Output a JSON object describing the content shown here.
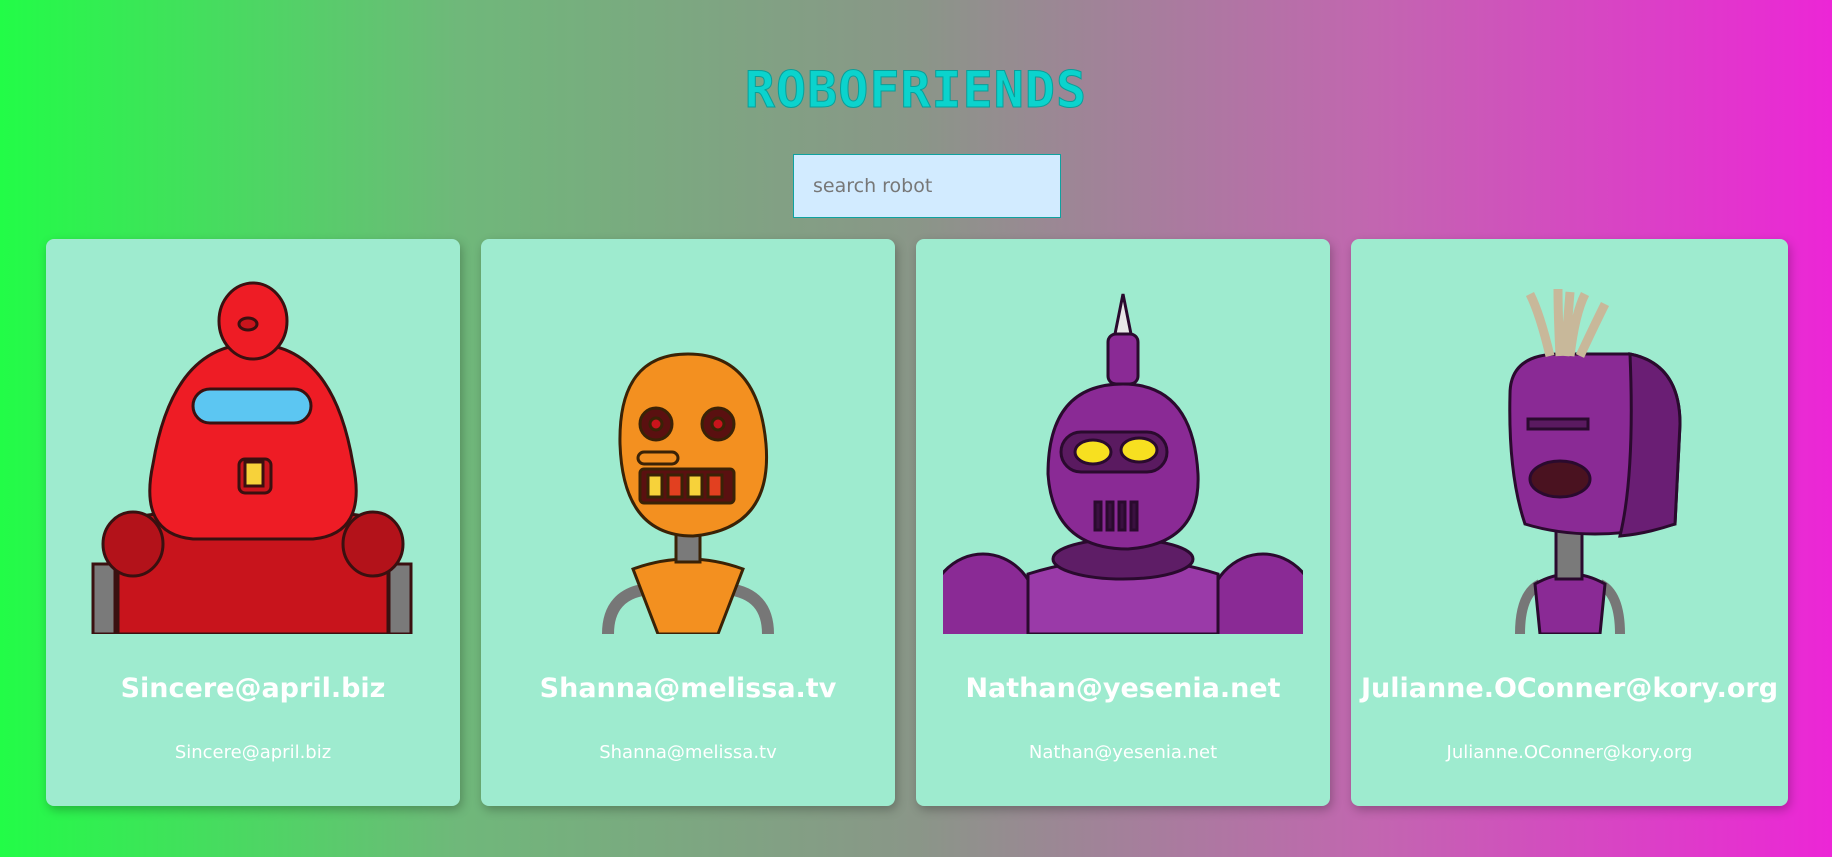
{
  "header": {
    "title": "RoboFriends"
  },
  "search": {
    "placeholder": "search robot",
    "value": ""
  },
  "colors": {
    "background_start": "#22fc47",
    "background_end": "#ec26d6",
    "card": "#9eebcf",
    "title": "#0bd3cd"
  },
  "robots": [
    {
      "name": "Sincere@april.biz",
      "email": "Sincere@april.biz",
      "icon": "red-robot-icon"
    },
    {
      "name": "Shanna@melissa.tv",
      "email": "Shanna@melissa.tv",
      "icon": "orange-robot-icon"
    },
    {
      "name": "Nathan@yesenia.net",
      "email": "Nathan@yesenia.net",
      "icon": "purple-horned-robot-icon"
    },
    {
      "name": "Julianne.OConner@kory.org",
      "email": "Julianne.OConner@kory.org",
      "icon": "purple-visor-robot-icon"
    }
  ]
}
